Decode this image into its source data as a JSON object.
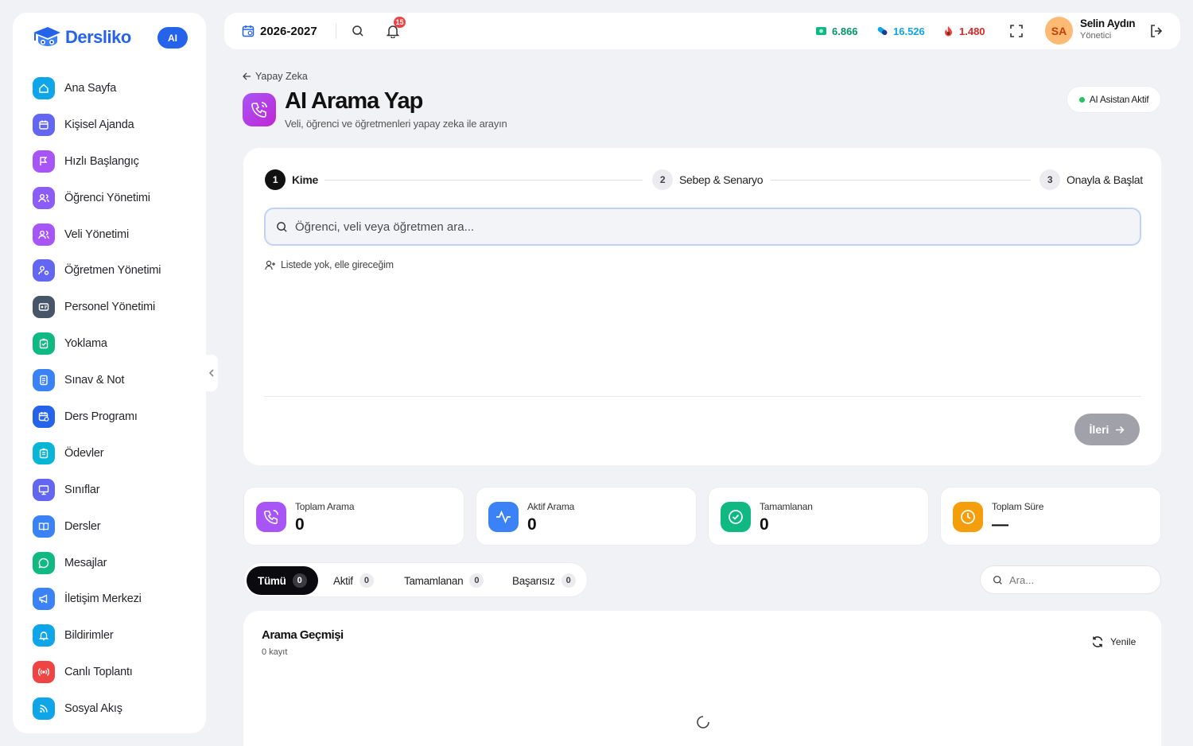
{
  "brand": {
    "name": "Dersliko",
    "ai_badge": "AI",
    "color": "#2563eb"
  },
  "sidebar": {
    "items": [
      {
        "label": "Ana Sayfa",
        "icon": "home-icon",
        "color": "#0ea5e9"
      },
      {
        "label": "Kişisel Ajanda",
        "icon": "calendar-icon",
        "color": "#6366f1"
      },
      {
        "label": "Hızlı Başlangıç",
        "icon": "flag-icon",
        "color": "#a855f7"
      },
      {
        "label": "Öğrenci Yönetimi",
        "icon": "users-icon",
        "color": "#8b5cf6"
      },
      {
        "label": "Veli Yönetimi",
        "icon": "users-icon",
        "color": "#a855f7"
      },
      {
        "label": "Öğretmen Yönetimi",
        "icon": "user-cog-icon",
        "color": "#6366f1"
      },
      {
        "label": "Personel Yönetimi",
        "icon": "id-card-icon",
        "color": "#475569"
      },
      {
        "label": "Yoklama",
        "icon": "clipboard-check-icon",
        "color": "#10b981"
      },
      {
        "label": "Sınav & Not",
        "icon": "document-icon",
        "color": "#3b82f6"
      },
      {
        "label": "Ders Programı",
        "icon": "calendar-clock-icon",
        "color": "#2563eb"
      },
      {
        "label": "Ödevler",
        "icon": "clipboard-list-icon",
        "color": "#06b6d4"
      },
      {
        "label": "Sınıflar",
        "icon": "presentation-icon",
        "color": "#6366f1"
      },
      {
        "label": "Dersler",
        "icon": "book-icon",
        "color": "#3b82f6"
      },
      {
        "label": "Mesajlar",
        "icon": "chat-icon",
        "color": "#10b981"
      },
      {
        "label": "İletişim Merkezi",
        "icon": "megaphone-icon",
        "color": "#3b82f6"
      },
      {
        "label": "Bildirimler",
        "icon": "bell-icon",
        "color": "#0ea5e9"
      },
      {
        "label": "Canlı Toplantı",
        "icon": "broadcast-icon",
        "color": "#ef4444"
      },
      {
        "label": "Sosyal Akış",
        "icon": "rss-icon",
        "color": "#0ea5e9"
      }
    ]
  },
  "topbar": {
    "year": "2026-2027",
    "notifications_count": "15",
    "stats": [
      {
        "value": "6.866",
        "icon": "cash-icon",
        "color": "#10b981"
      },
      {
        "value": "16.526",
        "icon": "pill-icon",
        "color": "#0ea5e9"
      },
      {
        "value": "1.480",
        "icon": "fire-icon",
        "color": "#ef4444"
      }
    ],
    "user": {
      "initials": "SA",
      "name": "Selin Aydın",
      "role": "Yönetici"
    }
  },
  "header": {
    "breadcrumb": "Yapay Zeka",
    "title": "AI Arama Yap",
    "subtitle": "Veli, öğrenci ve öğretmenleri yapay zeka ile arayın",
    "status_pill": "AI Asistan Aktif"
  },
  "wizard": {
    "steps": [
      {
        "num": "1",
        "label": "Kime",
        "active": true
      },
      {
        "num": "2",
        "label": "Sebep & Senaryo",
        "active": false
      },
      {
        "num": "3",
        "label": "Onayla & Başlat",
        "active": false
      }
    ],
    "search_placeholder": "Öğrenci, veli veya öğretmen ara...",
    "manual_entry": "Listede yok, elle gireceğim",
    "next_label": "İleri"
  },
  "stats": [
    {
      "label": "Toplam Arama",
      "value": "0",
      "icon": "phone-call-icon",
      "color": "#a855f7"
    },
    {
      "label": "Aktif Arama",
      "value": "0",
      "icon": "activity-icon",
      "color": "#3b82f6"
    },
    {
      "label": "Tamamlanan",
      "value": "0",
      "icon": "check-circle-icon",
      "color": "#10b981"
    },
    {
      "label": "Toplam Süre",
      "value": "—",
      "icon": "clock-icon",
      "color": "#f59e0b"
    }
  ],
  "filters": {
    "tabs": [
      {
        "label": "Tümü",
        "count": "0"
      },
      {
        "label": "Aktif",
        "count": "0"
      },
      {
        "label": "Tamamlanan",
        "count": "0"
      },
      {
        "label": "Başarısız",
        "count": "0"
      }
    ],
    "search_placeholder": "Ara..."
  },
  "history": {
    "title": "Arama Geçmişi",
    "count_text": "0 kayıt",
    "refresh_label": "Yenile"
  }
}
